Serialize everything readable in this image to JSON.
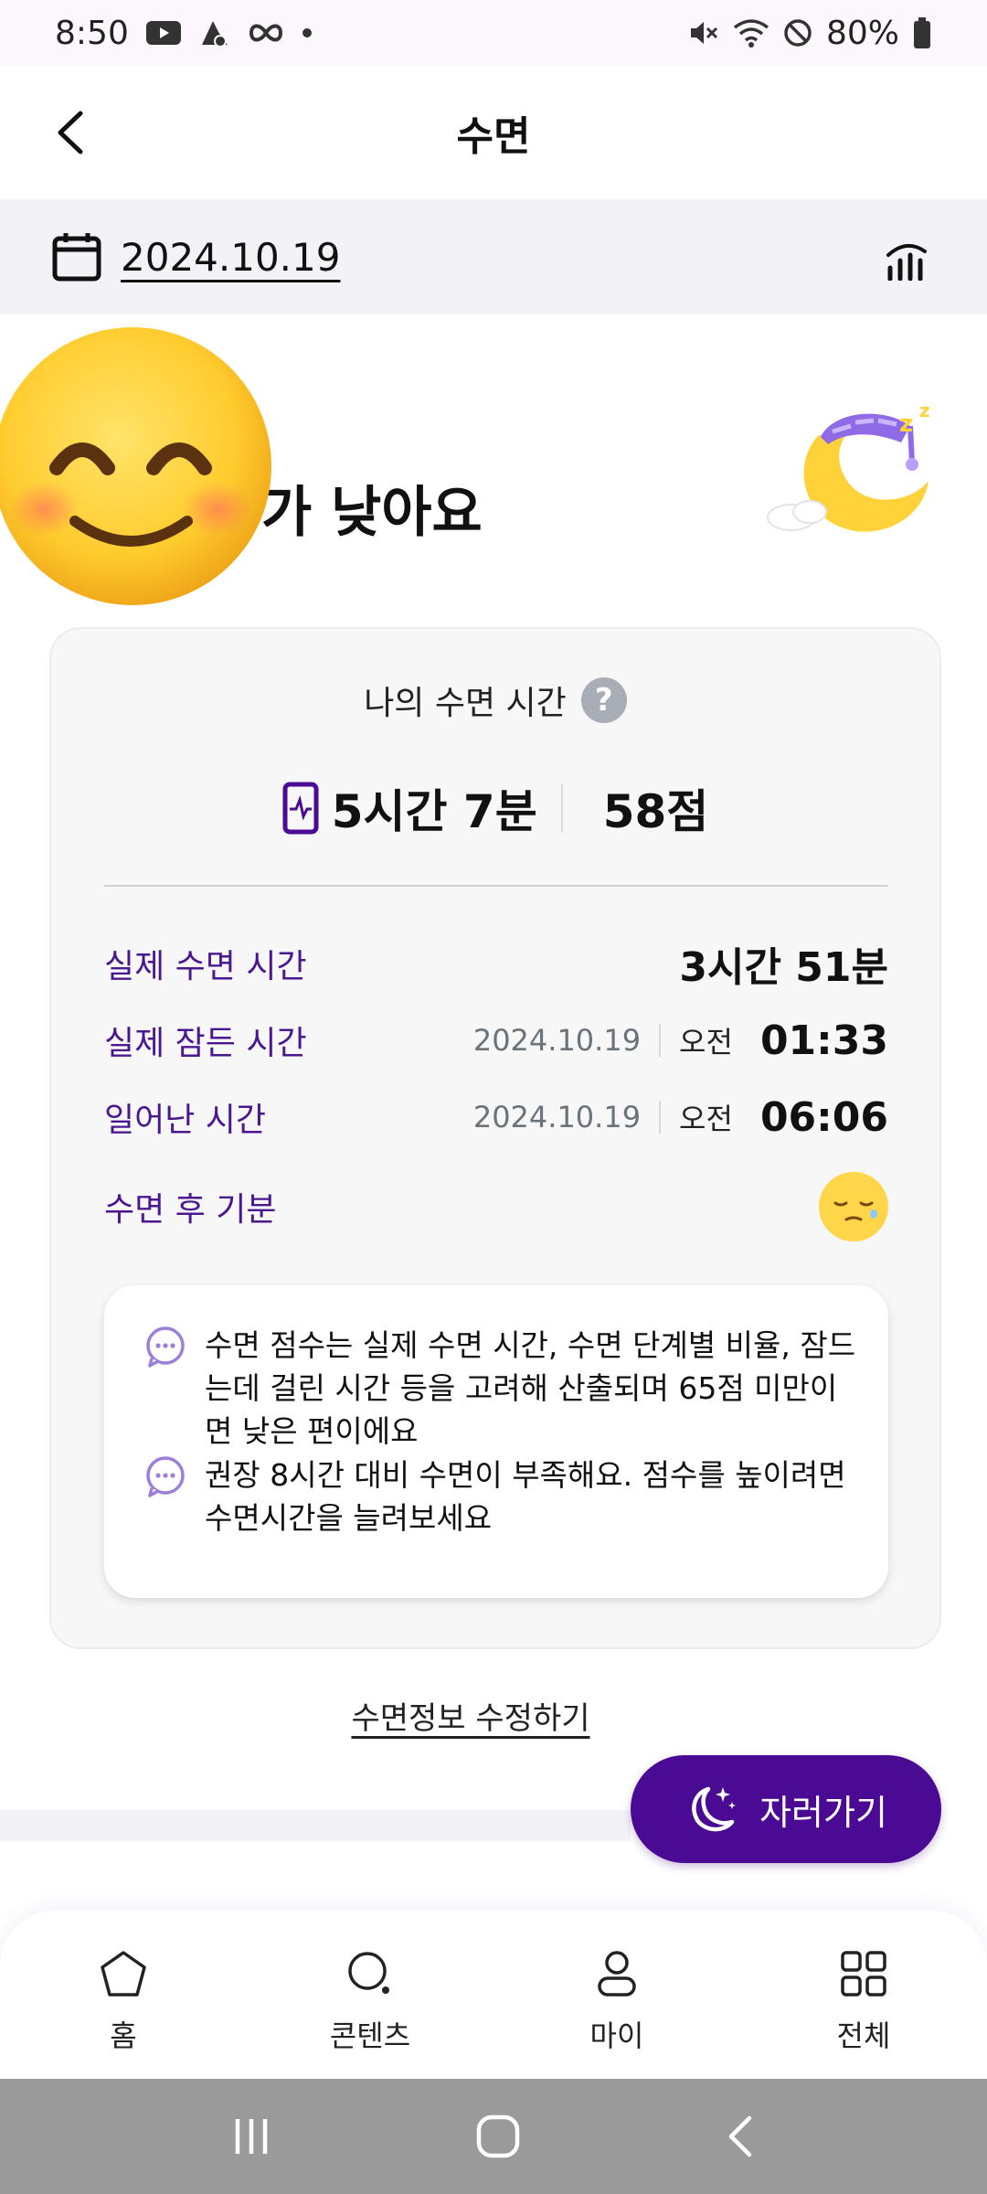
{
  "status_bar": {
    "time": "8:50",
    "battery": "80%",
    "icons_left": [
      "youtube-icon",
      "game-icon",
      "infinity-icon",
      "dot-icon"
    ],
    "icons_right": [
      "mute-icon",
      "wifi-icon",
      "dnd-icon",
      "battery-icon"
    ]
  },
  "header": {
    "title": "수면",
    "back_icon": "chevron-left-icon"
  },
  "date_bar": {
    "date": "2024.10.19",
    "calendar_icon": "calendar-icon",
    "stats_icon": "bar-chart-icon"
  },
  "hero": {
    "headline_visible": "가 낮아요",
    "emoji": "smiling-emoji-sticker",
    "illustration": "sleeping-moon-illustration"
  },
  "card": {
    "title": "나의 수면 시간",
    "help_label": "?",
    "duration": "5시간 7분",
    "score": "58점",
    "rows": [
      {
        "label": "실제 수면 시간",
        "value": "3시간 51분"
      },
      {
        "label": "실제 잠든 시간",
        "date": "2024.10.19",
        "ampm": "오전",
        "time": "01:33"
      },
      {
        "label": "일어난 시간",
        "date": "2024.10.19",
        "ampm": "오전",
        "time": "06:06"
      },
      {
        "label": "수면 후 기분",
        "mood_icon": "sleepy-face-icon"
      }
    ],
    "tips": [
      "수면 점수는 실제 수면 시간, 수면 단계별 비율, 잠드는데 걸린 시간 등을 고려해 산출되며 65점 미만이면 낮은 편이에요",
      "권장 8시간 대비 수면이 부족해요. 점수를 높이려면 수면시간을 늘려보세요"
    ]
  },
  "edit_link": "수면정보 수정하기",
  "sleep_button": "자러가기",
  "accent_color": "#4a0a93",
  "label_color": "#4a1791",
  "bottom_nav": [
    {
      "label": "홈",
      "icon": "home-icon"
    },
    {
      "label": "콘텐츠",
      "icon": "search-icon"
    },
    {
      "label": "마이",
      "icon": "person-icon"
    },
    {
      "label": "전체",
      "icon": "grid-icon"
    }
  ],
  "system_nav": [
    "recents-icon",
    "home-button-icon",
    "back-icon"
  ]
}
